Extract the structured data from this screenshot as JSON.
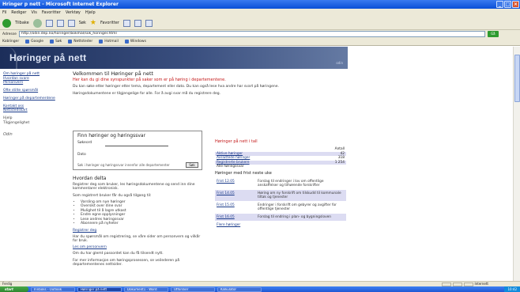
{
  "window": {
    "title": "Hringer p nett - Microsoft Internet Explorer",
    "buttons": [
      "_",
      "□",
      "×"
    ]
  },
  "menu": [
    "Fil",
    "Rediger",
    "Vis",
    "Favoritter",
    "Verktøy",
    "Hjelp"
  ],
  "toolbar": {
    "back_label": "Tilbake",
    "search_label": "Søk",
    "favorites_label": "Favoritter"
  },
  "address": {
    "label": "Adresse",
    "url": "http://odin.dep.no/horinger/bokmal/sok_horinger.html",
    "go_label": "Gå"
  },
  "links": {
    "label": "Koblinger",
    "items": [
      "Google",
      "Søk",
      "Nettsteder",
      "Hotmail",
      "Windows"
    ]
  },
  "site": {
    "logo_text": "Høringer på nett",
    "logo_sub": "odin"
  },
  "nav": {
    "items": [
      "Om høringer på nett",
      "Hvordan svare",
      "Personvern",
      "Ofte stilte spørsmål",
      "Høringer på departementene"
    ],
    "items2": [
      "Kontakt oss",
      "Nettstedskart"
    ],
    "items3": [
      "Hjelp",
      "Tilgjengelighet"
    ],
    "logo": "Odin"
  },
  "main": {
    "heading": "Velkommen til Høringer på nett",
    "red_line": "Her kan du gi dine synspunkter på saker som er på høring i departementene.",
    "para1": "Du kan søke etter høringer etter tema, departement eller dato. Du kan også lese hva andre har svart på høringene.",
    "para2": "Høringsdokumentene er tilgjengelige for alle. For å avgi svar må du registrere deg.",
    "search": {
      "title": "Finn høringer og høringssvar",
      "label_keyword": "Søkeord",
      "label_dept": "Dato",
      "bottom_text": "Søk i høringer og høringssvar innenfor alle departementer",
      "button": "Søk"
    },
    "section": {
      "heading": "Hvordan delta",
      "para": "Registrer deg som bruker, les høringsdokumentene og send inn dine kommentarer elektronisk.",
      "intro": "Som registrert bruker får du også tilgang til:",
      "bullets": [
        "Varsling om nye høringer",
        "Oversikt over dine svar",
        "Mulighet til å lagre utkast",
        "Endre egne opplysninger",
        "Lese andres høringssvar",
        "Abonnere på nyheter"
      ],
      "link1": "Registrer deg",
      "text2": "Har du spørsmål om registrering, se våre sider om personvern og vilkår for bruk.",
      "link2": "Les om personvern",
      "text3": "Om du har glemt passordet kan du få tilsendt nytt.",
      "text4": "For mer informasjon om høringsprosessen, se veilederen på departementenes nettsider."
    }
  },
  "panel": {
    "title": "Høringer på nett i tall",
    "rows": [
      {
        "label": "",
        "value": "Antall"
      },
      {
        "label": "Aktive høringer",
        "value": "42"
      },
      {
        "label": "Avsluttede høringer",
        "value": "318"
      },
      {
        "label": "Registrerte brukere",
        "value": "1 254"
      },
      {
        "label": "Alle høringssvar",
        "value": ""
      }
    ],
    "subtitle": "Høringer med frist neste uke",
    "blocks": [
      {
        "date": "Frist 12.05",
        "text": "Forslag til endringer i lov om offentlige anskaffelser og tilhørende forskrifter"
      },
      {
        "date": "Frist 14.05",
        "text": "Høring om ny forskrift om tilskudd til kommunale tiltak og tjenester"
      },
      {
        "date": "Frist 15.05",
        "text": "Endringer i forskrift om gebyrer og avgifter for offentlige tjenester"
      },
      {
        "date": "Frist 16.05",
        "text": "Forslag til endring i plan- og bygningsloven"
      },
      {
        "date": "Flere høringer",
        "text": ""
      }
    ]
  },
  "status": {
    "text": "Ferdig",
    "zone": "Internett"
  },
  "taskbar": {
    "start": "start",
    "tasks": [
      "Innboks - Outlook",
      "Høringer på nett",
      "Dokument1 - Word",
      "Utforsker",
      "Kalkulator"
    ],
    "clock": "10:42"
  }
}
